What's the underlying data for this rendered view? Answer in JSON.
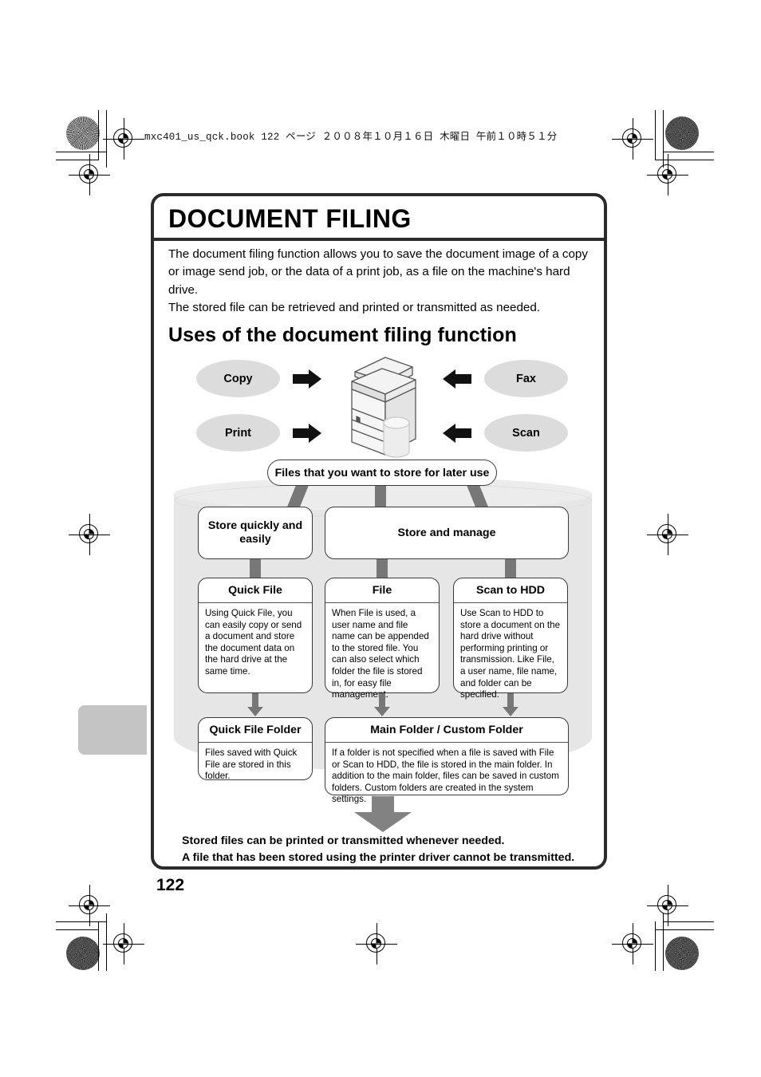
{
  "print_header": "mxc401_us_qck.book   122 ページ   ２００８年１０月１６日   木曜日   午前１０時５１分",
  "page_number": "122",
  "frame": {
    "title": "DOCUMENT FILING",
    "intro_line1": "The document filing function allows you to save the document image of a copy or image send job, or the data of a print job, as a file on the machine's hard drive.",
    "intro_line2": "The stored file can be retrieved and printed or transmitted as needed.",
    "subtitle": "Uses of the document filing function"
  },
  "sources": {
    "copy": "Copy",
    "print": "Print",
    "fax": "Fax",
    "scan": "Scan",
    "arrow_copy": "right-arrow-icon",
    "arrow_print": "right-arrow-icon",
    "arrow_fax": "left-arrow-icon",
    "arrow_scan": "left-arrow-icon",
    "device": "multifunction-printer-icon"
  },
  "flow": {
    "banner": "Files that you want to store for later use",
    "branch_quick": "Store quickly and easily",
    "branch_manage": "Store and manage",
    "methods": [
      {
        "title": "Quick File",
        "body": "Using Quick File, you can easily copy or send a document and store the document data on the hard drive at the same time."
      },
      {
        "title": "File",
        "body": "When File is used, a user name and file name can be appended to the stored file. You can also select which folder the file is stored in, for easy file management."
      },
      {
        "title": "Scan to HDD",
        "body": "Use Scan to HDD to store a document on the hard drive without performing printing or transmission. Like File, a user name, file name, and folder can be specified."
      }
    ],
    "folders": [
      {
        "title": "Quick File Folder",
        "body": "Files saved with Quick File are stored in this folder."
      },
      {
        "title": "Main Folder / Custom Folder",
        "body": "If a folder is not specified when a file is saved with File or Scan to HDD, the file is stored in the main folder. In addition to the main folder, files can be saved in custom folders. Custom folders are created in the system settings."
      }
    ]
  },
  "closing": {
    "line1": "Stored files can be printed or transmitted whenever needed.",
    "line2": "A file that has been stored using the printer driver cannot be transmitted."
  },
  "colors": {
    "frame_border": "#2b2b2b",
    "oval_fill": "#dcdcdc",
    "cylinder_fill": "#e6e6e6",
    "connector_gray": "#777777",
    "side_tab": "#c4c4c4"
  }
}
